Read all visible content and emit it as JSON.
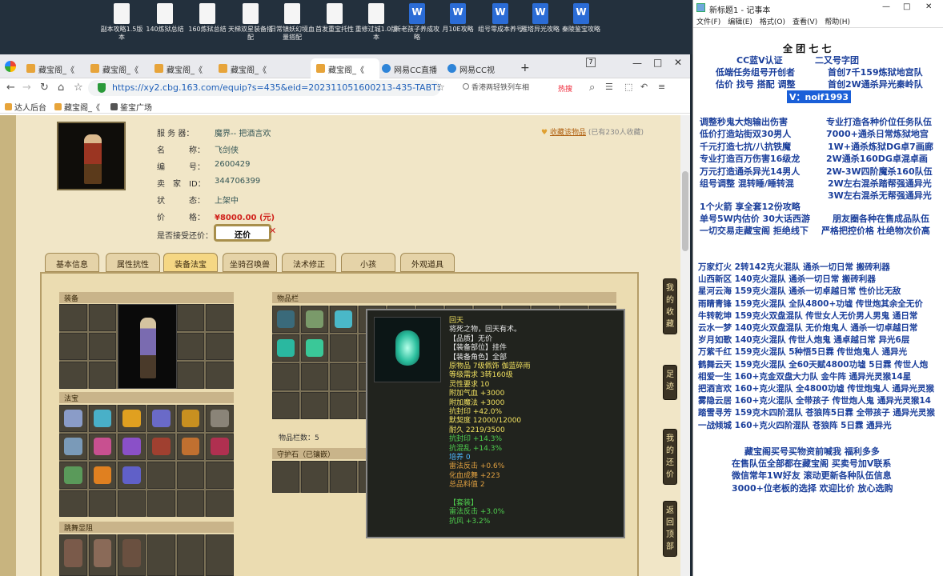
{
  "desktop": {
    "icons": [
      {
        "label": "副本攻略1.5版本",
        "kind": "doc"
      },
      {
        "label": "140炼狱总结",
        "kind": "doc"
      },
      {
        "label": "160炼狱总结",
        "kind": "doc"
      },
      {
        "label": "天梯双星装备搭配",
        "kind": "doc"
      },
      {
        "label": "日常镇妖幻境血量搭配",
        "kind": "doc"
      },
      {
        "label": "首发重宝托性",
        "kind": "doc"
      },
      {
        "label": "重修过城1.0版本",
        "kind": "doc"
      },
      {
        "label": "新老孩子养成攻略",
        "kind": "word"
      },
      {
        "label": "月10E攻略",
        "kind": "word"
      },
      {
        "label": "组号零成本养号",
        "kind": "word"
      },
      {
        "label": "雁塔异光攻略",
        "kind": "word"
      },
      {
        "label": "秦陵鉴宝攻略",
        "kind": "word"
      }
    ]
  },
  "browser": {
    "tabs": [
      "藏宝阁_《",
      "藏宝阁_《",
      "藏宝阁_《",
      "藏宝阁_《",
      "藏宝阁_《",
      "网易CC直播",
      "网易CC视",
      "+"
    ],
    "url": "https://xy2.cbg.163.com/equip?s=435&eid=202311051600213-435-TABT3EMSUXVJ&c",
    "search_hint": "香港两轻铁列车相",
    "hot_label": "热搜",
    "bookmarks": [
      "达人后台",
      "藏宝阁_《",
      "鉴宝广场"
    ],
    "tab_badge": "7"
  },
  "role": {
    "server_label": "服 务 器：",
    "server": "魔界-- 把酒言欢",
    "name_label": "名　　　称：",
    "name": "飞剑侠",
    "id_label": "编　　　号：",
    "id": "2600429",
    "seller_label": "卖　家　ID：",
    "seller": "344706399",
    "status_label": "状　　　态：",
    "status": "上架中",
    "price_label": "价　　　格：",
    "price": "¥8000.00 (元)",
    "bargain_label": "是否接受还价：",
    "bargain_button": "还价",
    "fav_text": "收藏该物品",
    "fav_count": "(已有230人收藏)"
  },
  "game_tabs": [
    "基本信息",
    "属性抗性",
    "装备法宝",
    "坐骑召唤兽",
    "法术修正",
    "小孩",
    "外观道具"
  ],
  "active_game_tab": 2,
  "sections": {
    "equip": "装备",
    "items": "物品栏",
    "fabao": "法宝",
    "pets": "跳舞显阻",
    "item_count_label": "物品栏数：",
    "item_count": "5",
    "guard": "守护石（已镶嵌）"
  },
  "side_buttons": [
    "我的收藏",
    "足迹",
    "我的还价",
    "返回顶部"
  ],
  "tooltip": {
    "lines": [
      {
        "t": "回天",
        "c": "#f0e060"
      },
      {
        "t": "将死之物，回天有术。",
        "c": "#e8e8e8"
      },
      {
        "t": "【品质】无价",
        "c": "#e8e8e8"
      },
      {
        "t": "【装备部位】挂件",
        "c": "#e8e8e8"
      },
      {
        "t": "【装备角色】全部",
        "c": "#e8e8e8"
      },
      {
        "t": "原物品 7级佩饰 伽蓝碎雨",
        "c": "#f0e060"
      },
      {
        "t": "等级需求 3转160级",
        "c": "#f0e060"
      },
      {
        "t": "灵性要求 10",
        "c": "#f0e060"
      },
      {
        "t": "附加气血 +3000",
        "c": "#f0e060"
      },
      {
        "t": "附加魔法 +3000",
        "c": "#f0e060"
      },
      {
        "t": "抗封印 +42.0%",
        "c": "#f0e060"
      },
      {
        "t": "默契度 12000/12000",
        "c": "#f0e060"
      },
      {
        "t": "耐久 2219/3500",
        "c": "#f0e060"
      },
      {
        "t": "抗封印 +14.3%",
        "c": "#4fd04f"
      },
      {
        "t": "抗混乱 +14.3%",
        "c": "#4fd04f"
      },
      {
        "t": "培养 0",
        "c": "#4fb8ff"
      },
      {
        "t": "雷法反击 +0.6%",
        "c": "#e0a040"
      },
      {
        "t": "化血成舞 +223",
        "c": "#e0a040"
      },
      {
        "t": "总品料值 2",
        "c": "#e0a040"
      },
      {
        "t": "",
        "c": "#e8e8e8"
      },
      {
        "t": "【套装】",
        "c": "#4fd04f"
      },
      {
        "t": "雷法反击 +3.0%",
        "c": "#4fd04f"
      },
      {
        "t": "抗风 +3.2%",
        "c": "#4fd04f"
      }
    ]
  },
  "notepad": {
    "title": "新标题1 - 记事本",
    "menu": [
      "文件(F)",
      "编辑(E)",
      "格式(O)",
      "查看(V)",
      "帮助(H)"
    ],
    "header_partial": "全 团 七 七",
    "blue_line": "CC蓝V认证",
    "blue_line_right": "二又号字团",
    "left_a": "低端任务组号开创者",
    "right_a": "首创7千159炼狱地宫队",
    "left_b": "估价 找号 搭配 调整",
    "right_b": "首创2W通杀异光秦岭队",
    "vx": "V：noif1993",
    "services_left": [
      "调整秒鬼大炮输出伤害",
      "低价打造站街双30男人",
      "千元打造七抗/八抗铁魔",
      "专业打造百万伤害16级龙",
      "万元打造通杀异光14男人",
      "组号调整 混转睡/睡转混"
    ],
    "services_right": [
      "专业打造各种价位任务队伍",
      "7000+通杀日常炼狱地宫",
      "1W+通杀炼狱DG卓7画廊",
      "2W通杀160DG卓混卓画",
      "2W-3W四阶魔杀160队伍",
      "2W左右混杀踏帮强通异光",
      "3W左右混杀无帮强通异光"
    ],
    "promo_1": "1个火箭 享全套12份攻略",
    "promo_2a": "单号5W内估价 30大话西游",
    "promo_2b": "朋友圈各种在售成品队伍",
    "promo_3a": "一切交易走藏宝阁 拒绝线下",
    "promo_3b": "严格把控价格 杜绝物次价高",
    "listings": [
      "万家灯火 2转142克火混队 通杀一切日常 搬砖利器",
      "山西新区 140克火混队 通杀一切日常 搬砖利器",
      "星河云海 159克火混队 通杀一切卓越日常 性价比无敌",
      "雨睛青锋 159克火混队 全队4800+功墟 传世炮其余全无价",
      "牛转乾坤 159克火双盘混队 传世女人无价男人男鬼 通日常",
      "云水一梦 140克火双盘混队 无价炮鬼人 通杀一切卓越日常",
      "岁月如歌 140克火混队 传世人炮鬼 通卓越日常 异光6层",
      "万紫千红 159克火混队 5种悟5日霖 传世炮鬼人 通异光",
      "鹤舞云天 159克火混队 全60天赋4800功墟 5日霖 传世人炮",
      "相爱一生 160+克金双盘大力队 金牛阵 通异光灵猴14星",
      "把酒言欢 160+克火混队 全4800功墟 传世炮鬼人 通异光灵猴",
      "雾隐云居 160+克火混队 全带孩子 传世炮人鬼 通异光灵猴14",
      "踏雪寻芳 159克木四阶混队 苍狼阵5日霖 全带孩子 通异光灵猴",
      "一战倾城 160+克火四阶混队 苍狼阵 5日霖 通异光"
    ],
    "footer": [
      "藏宝阁买号买物资前喊我 福利多多",
      "在售队伍全部都在藏宝阁 买卖号加V联系",
      "微信常年1W好友 滚动更新各种队伍信息",
      "3000+位老板的选择 欢迎比价 放心选购"
    ]
  }
}
